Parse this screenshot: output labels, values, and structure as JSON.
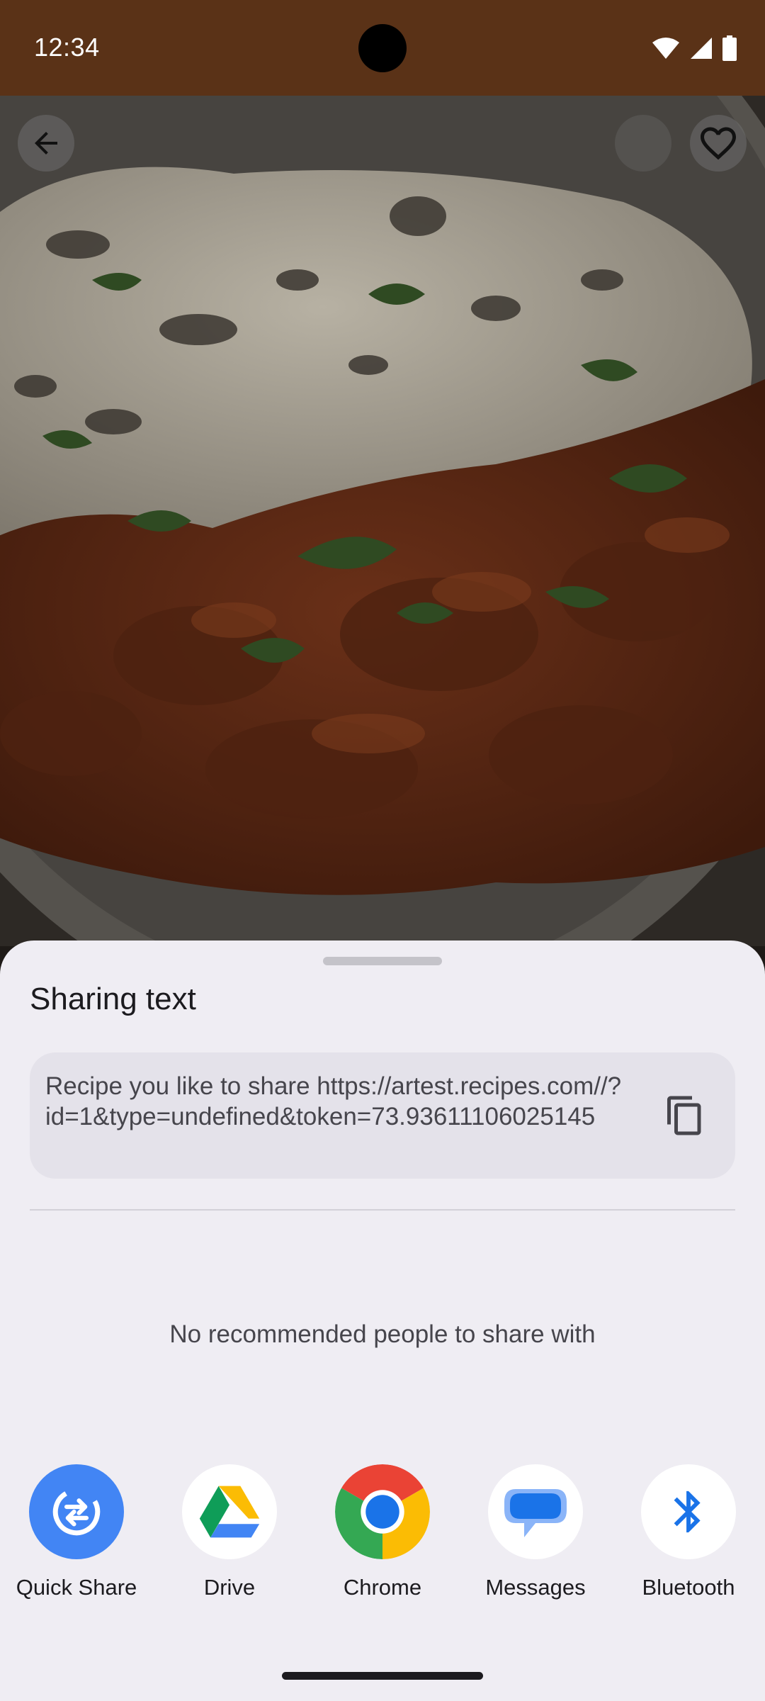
{
  "status_bar": {
    "time": "12:34",
    "icons": [
      "wifi-icon",
      "cellular-signal-icon",
      "battery-icon"
    ]
  },
  "hero": {
    "image": "butter chicken curry with naan bread on a plate (dimmed)",
    "back_icon": "arrow-left-icon",
    "favorite_icon": "heart-outline-icon"
  },
  "sheet": {
    "title": "Sharing text",
    "share_text": "Recipe you like to share https://artest.recipes.com//?id=1&type=undefined&token=73.93611106025145",
    "copy_icon": "copy-icon",
    "no_people_text": "No recommended people to share with",
    "apps": [
      {
        "label": "Quick Share",
        "icon": "quick-share-icon"
      },
      {
        "label": "Drive",
        "icon": "drive-icon"
      },
      {
        "label": "Chrome",
        "icon": "chrome-icon"
      },
      {
        "label": "Messages",
        "icon": "messages-icon"
      },
      {
        "label": "Bluetooth",
        "icon": "bluetooth-icon"
      }
    ]
  },
  "colors": {
    "status_bar_bg": "#5a3217",
    "sheet_bg": "#efedf3",
    "share_card_bg": "#e4e2ea",
    "quick_share_blue": "#4285f4"
  }
}
